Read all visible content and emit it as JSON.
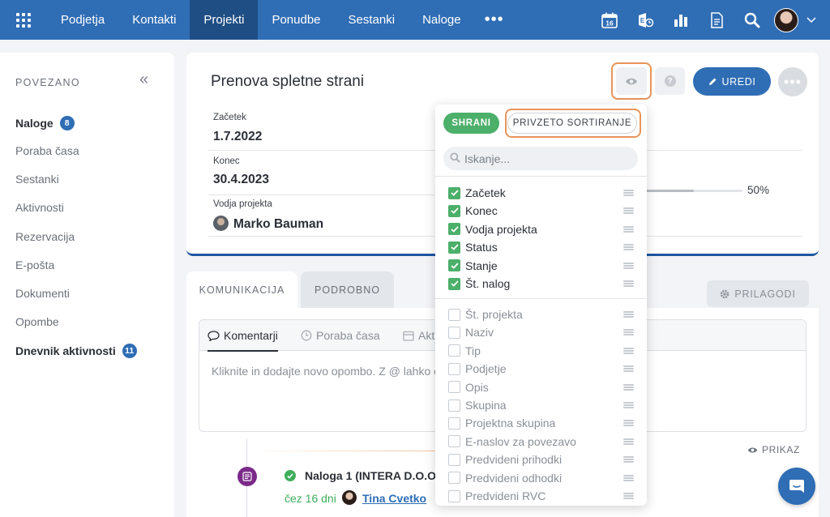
{
  "topnav": {
    "items": [
      "Podjetja",
      "Kontakti",
      "Projekti",
      "Ponudbe",
      "Sestanki",
      "Naloge"
    ],
    "active": "Projekti",
    "more": "•••",
    "calendar_day": "16",
    "icons": [
      "apps-grid-icon",
      "calendar-icon",
      "exchange-icon",
      "reports-icon",
      "document-icon",
      "search-icon",
      "avatar",
      "chevron-down-icon"
    ]
  },
  "sidebar": {
    "title": "POVEZANO",
    "collapse": "«",
    "items": [
      {
        "label": "Naloge",
        "badge": "8",
        "bold": true
      },
      {
        "label": "Poraba časa"
      },
      {
        "label": "Sestanki"
      },
      {
        "label": "Aktivnosti"
      },
      {
        "label": "Rezervacija"
      },
      {
        "label": "E-pošta"
      },
      {
        "label": "Dokumenti"
      },
      {
        "label": "Opombe"
      },
      {
        "label": "Dnevnik aktivnosti",
        "badge": "11",
        "bold": true
      }
    ]
  },
  "header": {
    "title": "Prenova spletne strani",
    "edit_label": "UREDI",
    "more_label": "•••",
    "help_label": "?",
    "fields": {
      "start_label": "Začetek",
      "start_value": "1.7.2022",
      "end_label": "Konec",
      "end_value": "30.4.2023",
      "manager_label": "Vodja projekta",
      "manager_value": "Marko Bauman"
    },
    "progress": {
      "value": 50,
      "label": "50%"
    }
  },
  "tabs": {
    "items": [
      "KOMUNIKACIJA",
      "PODROBNO"
    ],
    "active": "KOMUNIKACIJA",
    "customize_label": "PRILAGODI"
  },
  "comment": {
    "tabs": [
      "Komentarji",
      "Poraba časa",
      "Akt"
    ],
    "placeholder": "Kliknite in dodajte novo opombo. Z @ lahko o"
  },
  "timeline": {
    "view_label": "PRIKAZ",
    "task_title": "Naloga 1 (INTERA D.O.O.)",
    "task_due": "čez 16 dni",
    "task_assignee": "Tina Cvetko"
  },
  "dropdown": {
    "save_label": "SHRANI",
    "sort_label": "PRIVZETO SORTIRANJE",
    "search_placeholder": "Iskanje...",
    "selected": [
      "Začetek",
      "Konec",
      "Vodja projekta",
      "Status",
      "Stanje",
      "Št. nalog"
    ],
    "unselected": [
      "Št. projekta",
      "Naziv",
      "Tip",
      "Podjetje",
      "Opis",
      "Skupina",
      "Projektna skupina",
      "E-naslov za povezavo",
      "Predvideni prihodki",
      "Predvideni odhodki",
      "Predvideni RVC"
    ]
  },
  "colors": {
    "brand": "#2f6db5",
    "nav_active": "#1f4e85",
    "success": "#4caf6a",
    "highlight_outline": "#e8955a",
    "task_icon": "#7b2a8a"
  }
}
